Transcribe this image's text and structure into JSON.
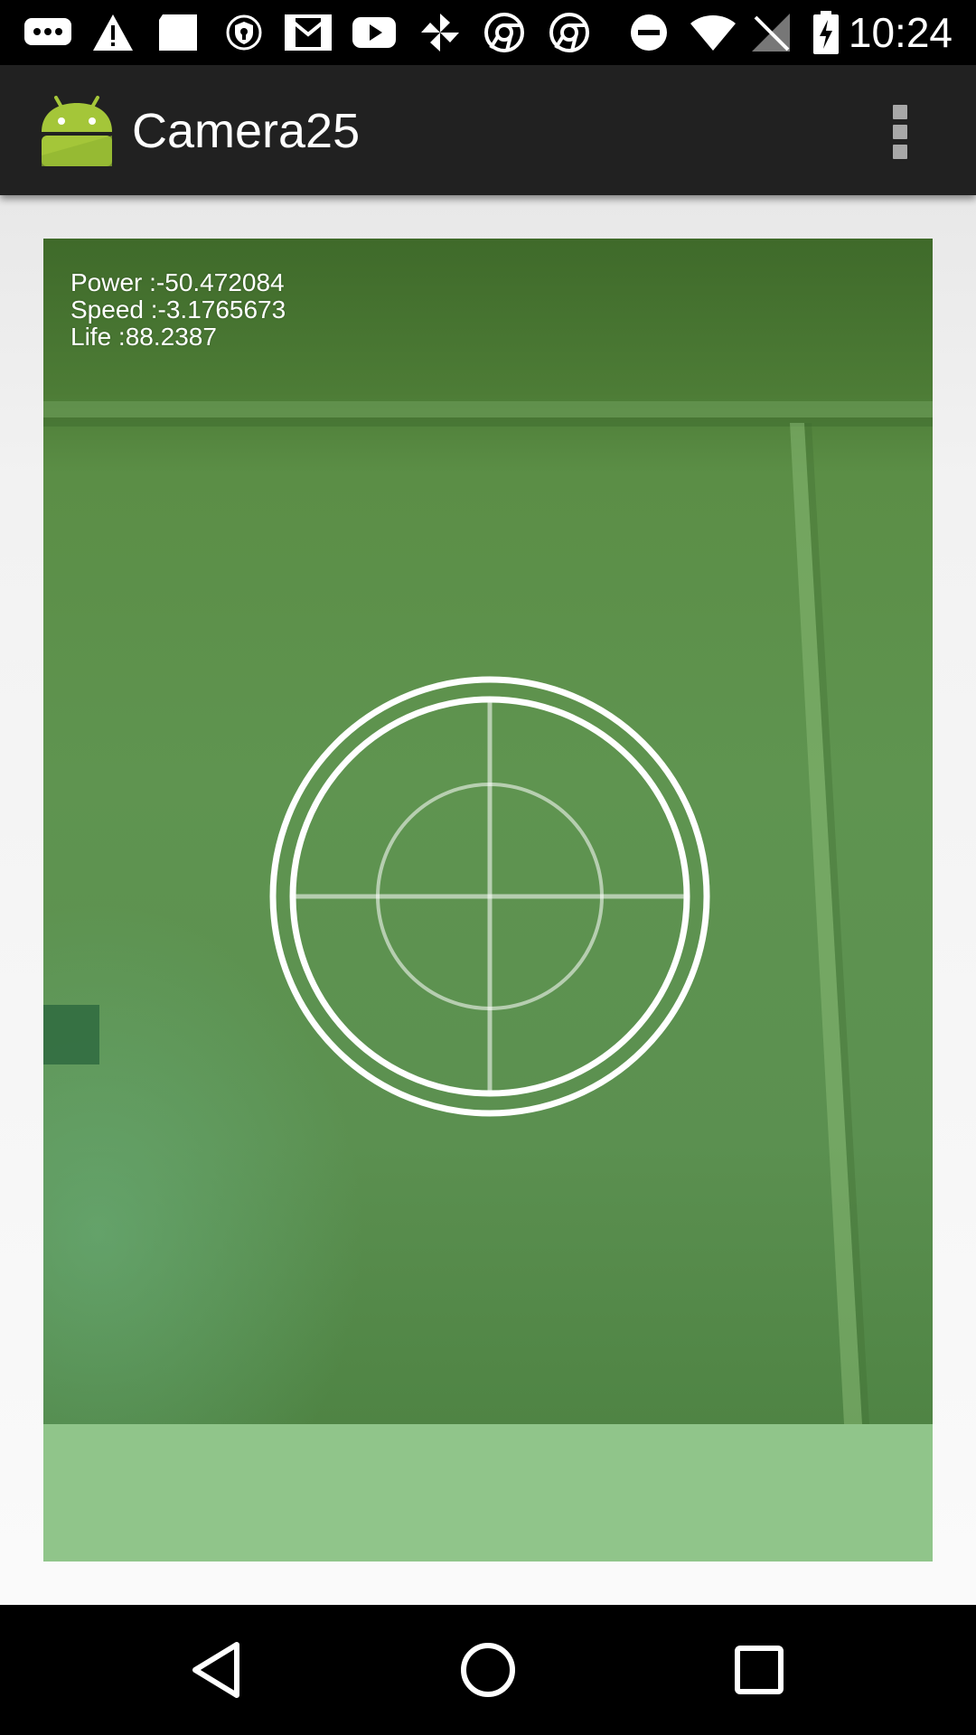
{
  "status_bar": {
    "time": "10:24",
    "icons": [
      "messaging-dots-icon",
      "warning-icon",
      "notification-square-icon",
      "shield-icon",
      "gmail-icon",
      "youtube-icon",
      "pinwheel-icon",
      "chrome-icon",
      "chrome-icon",
      "do-not-disturb-icon",
      "wifi-icon",
      "no-sim-icon",
      "battery-charging-icon"
    ]
  },
  "app_bar": {
    "title": "Camera25",
    "logo_icon": "android-robot-icon",
    "menu_icon": "overflow-menu-icon"
  },
  "hud": {
    "power": "Power :-50.472084",
    "speed": "Speed :-3.1765673",
    "life": "Life :88.2387"
  },
  "camera": {
    "overlay": "crosshair-reticle",
    "tint_color": "#5b8e46",
    "bottom_panel_color": "#90c58a"
  },
  "nav_bar": {
    "back": "back-icon",
    "home": "home-icon",
    "recents": "recents-icon"
  }
}
